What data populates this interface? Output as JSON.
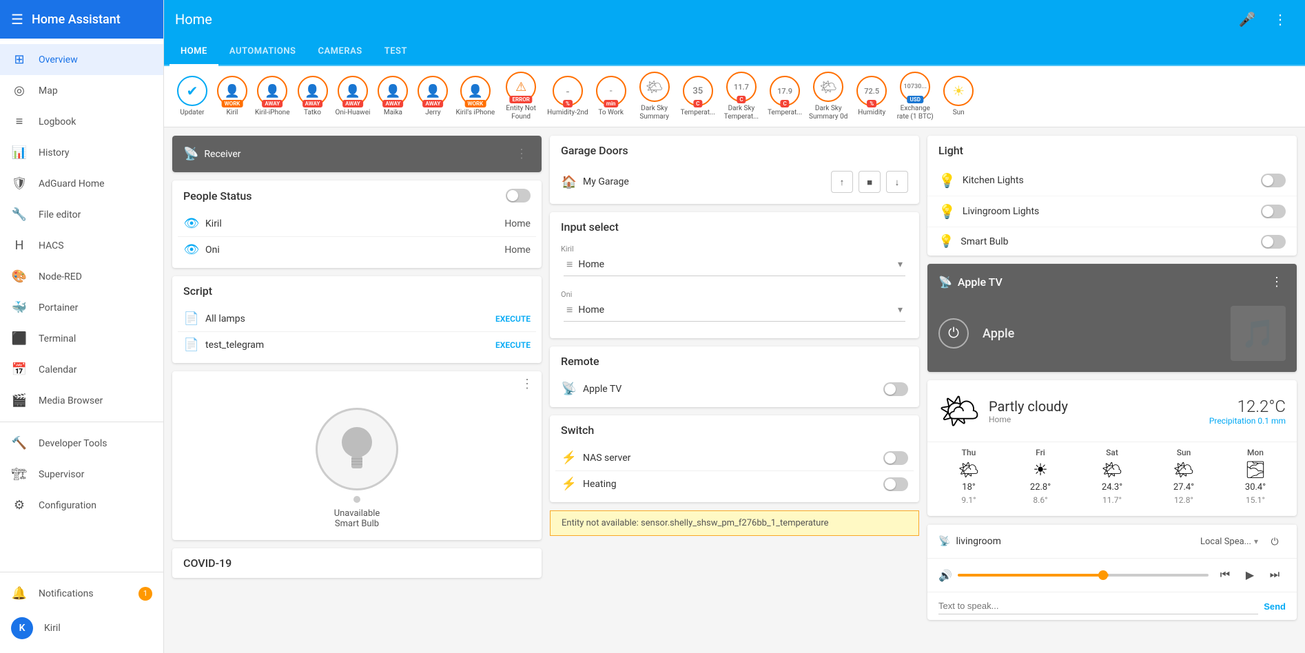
{
  "sidebar": {
    "title": "Home Assistant",
    "items": [
      {
        "id": "overview",
        "label": "Overview",
        "icon": "⊞",
        "active": true
      },
      {
        "id": "map",
        "label": "Map",
        "icon": "◉"
      },
      {
        "id": "logbook",
        "label": "Logbook",
        "icon": "☰"
      },
      {
        "id": "history",
        "label": "History",
        "icon": "📊"
      },
      {
        "id": "adguard",
        "label": "AdGuard Home",
        "icon": "🛡"
      },
      {
        "id": "file-editor",
        "label": "File editor",
        "icon": "🔧"
      },
      {
        "id": "hacs",
        "label": "HACS",
        "icon": "🅷"
      },
      {
        "id": "node-red",
        "label": "Node-RED",
        "icon": "🎨"
      },
      {
        "id": "portainer",
        "label": "Portainer",
        "icon": "🐳"
      },
      {
        "id": "terminal",
        "label": "Terminal",
        "icon": "⬛"
      },
      {
        "id": "calendar",
        "label": "Calendar",
        "icon": "📅"
      },
      {
        "id": "media-browser",
        "label": "Media Browser",
        "icon": "🎬"
      },
      {
        "id": "developer-tools",
        "label": "Developer Tools",
        "icon": "🔨",
        "section": true
      },
      {
        "id": "supervisor",
        "label": "Supervisor",
        "icon": "🏗"
      },
      {
        "id": "configuration",
        "label": "Configuration",
        "icon": "⚙"
      }
    ],
    "notifications": {
      "label": "Notifications",
      "count": "1"
    },
    "user": {
      "label": "Kiril",
      "avatar": "K"
    }
  },
  "topbar": {
    "title": "Home",
    "mic_label": "🎤",
    "more_label": "⋮"
  },
  "nav_tabs": [
    {
      "id": "home",
      "label": "HOME",
      "active": true
    },
    {
      "id": "automations",
      "label": "AUTOMATIONS"
    },
    {
      "id": "cameras",
      "label": "CAMERAS"
    },
    {
      "id": "test",
      "label": "TEST"
    }
  ],
  "entity_strip": [
    {
      "id": "updater",
      "label": "Updater",
      "badge": null,
      "border": "blue-border",
      "check": true
    },
    {
      "id": "kiril",
      "label": "Kiril",
      "badge": "WORK",
      "badge_color": "orange",
      "border": "orange-border"
    },
    {
      "id": "kiril-iphone",
      "label": "Kiril-iPhone",
      "badge": "AWAY",
      "badge_color": "red",
      "border": "orange-border"
    },
    {
      "id": "tatko",
      "label": "Tatko",
      "badge": "AWAY",
      "badge_color": "red",
      "border": "orange-border"
    },
    {
      "id": "oni-huawei",
      "label": "Oni-Huawei",
      "badge": "AWAY",
      "badge_color": "red",
      "border": "orange-border"
    },
    {
      "id": "maika",
      "label": "Maika",
      "badge": "AWAY",
      "badge_color": "red",
      "border": "orange-border"
    },
    {
      "id": "jerry",
      "label": "Jerry",
      "badge": "AWAY",
      "badge_color": "red",
      "border": "orange-border"
    },
    {
      "id": "kirils-iphone",
      "label": "Kiril's iPhone",
      "badge": "WORK",
      "badge_color": "orange",
      "border": "orange-border"
    },
    {
      "id": "entity-not-found",
      "label": "Entity Not Found",
      "badge": "ERROR",
      "badge_color": "red",
      "border": "orange-border"
    },
    {
      "id": "humidity-2nd",
      "label": "Humidity-2nd",
      "badge": "%",
      "badge_color": "red",
      "border": "orange-border",
      "value": "-"
    },
    {
      "id": "to-work",
      "label": "To Work",
      "badge": "min",
      "badge_color": "red",
      "border": "orange-border",
      "value": "-"
    },
    {
      "id": "dark-sky-summary",
      "label": "Dark Sky Summary",
      "badge": null,
      "border": "orange-border"
    },
    {
      "id": "temp-2nd",
      "label": "Temperat...",
      "badge": "C",
      "badge_color": "red",
      "border": "orange-border",
      "value": "35"
    },
    {
      "id": "dark-sky-temp",
      "label": "Dark Sky Temperat...",
      "badge": "C",
      "badge_color": "red",
      "border": "orange-border",
      "value": "11.7"
    },
    {
      "id": "temp-outside",
      "label": "Temperat...",
      "badge": "C",
      "badge_color": "red",
      "border": "orange-border",
      "value": "17.9"
    },
    {
      "id": "dark-sky-summary-0d",
      "label": "Dark Sky Summary 0d",
      "badge": null,
      "border": "orange-border"
    },
    {
      "id": "humidity",
      "label": "Humidity",
      "badge": "%",
      "badge_color": "red",
      "border": "orange-border",
      "value": "72.5"
    },
    {
      "id": "exchange-rate",
      "label": "Exchange rate (1 BTC)",
      "badge": "USD",
      "badge_color": "blue",
      "border": "orange-border",
      "value": "10730..."
    },
    {
      "id": "sun",
      "label": "Sun",
      "badge": null,
      "border": "orange-border"
    }
  ],
  "people_status": {
    "title": "People Status",
    "people": [
      {
        "name": "Kiril",
        "status": "Home"
      },
      {
        "name": "Oni",
        "status": "Home"
      }
    ]
  },
  "script": {
    "title": "Script",
    "items": [
      {
        "label": "All lamps",
        "action": "EXECUTE"
      },
      {
        "label": "test_telegram",
        "action": "EXECUTE"
      }
    ]
  },
  "smart_bulb": {
    "status": "Unavailable",
    "name": "Smart Bulb"
  },
  "covid": {
    "title": "COVID-19"
  },
  "garage": {
    "title": "Garage Doors",
    "doors": [
      {
        "label": "My Garage"
      }
    ]
  },
  "input_select": {
    "title": "Input select",
    "selects": [
      {
        "person": "Kiril",
        "value": "Home"
      },
      {
        "person": "Oni",
        "value": "Home"
      }
    ]
  },
  "remote": {
    "title": "Remote",
    "items": [
      {
        "label": "Apple TV",
        "state": false
      }
    ]
  },
  "switch": {
    "title": "Switch",
    "items": [
      {
        "label": "NAS server",
        "state": false
      },
      {
        "label": "Heating",
        "state": false
      }
    ]
  },
  "entity_error": {
    "message": "Entity not available: sensor.shelly_shsw_pm_f276bb_1_temperature"
  },
  "light": {
    "title": "Light",
    "items": [
      {
        "label": "Kitchen Lights",
        "state": false
      },
      {
        "label": "Livingroom Lights",
        "state": false
      },
      {
        "label": "Smart Bulb",
        "state": false
      }
    ]
  },
  "apple_tv": {
    "title": "Apple TV",
    "label": "Apple"
  },
  "weather": {
    "condition": "Partly cloudy",
    "location": "Home",
    "temp": "12.2°C",
    "precip": "Precipitation 0.1 mm",
    "forecast": [
      {
        "day": "Thu",
        "icon": "🌤",
        "high": "18°",
        "low": "9.1°"
      },
      {
        "day": "Fri",
        "icon": "☀",
        "high": "22.8°",
        "low": "8.6°"
      },
      {
        "day": "Sat",
        "icon": "🌤",
        "high": "24.3°",
        "low": "11.7°"
      },
      {
        "day": "Sun",
        "icon": "🌤",
        "high": "27.4°",
        "low": "12.8°"
      },
      {
        "day": "Mon",
        "icon": "🌫",
        "high": "30.4°",
        "low": "15.1°"
      }
    ]
  },
  "media_player": {
    "device": "livingroom",
    "source": "Local Spea...",
    "tts_placeholder": "Text to speak...",
    "send_label": "Send"
  },
  "receiver": {
    "label": "Receiver"
  }
}
